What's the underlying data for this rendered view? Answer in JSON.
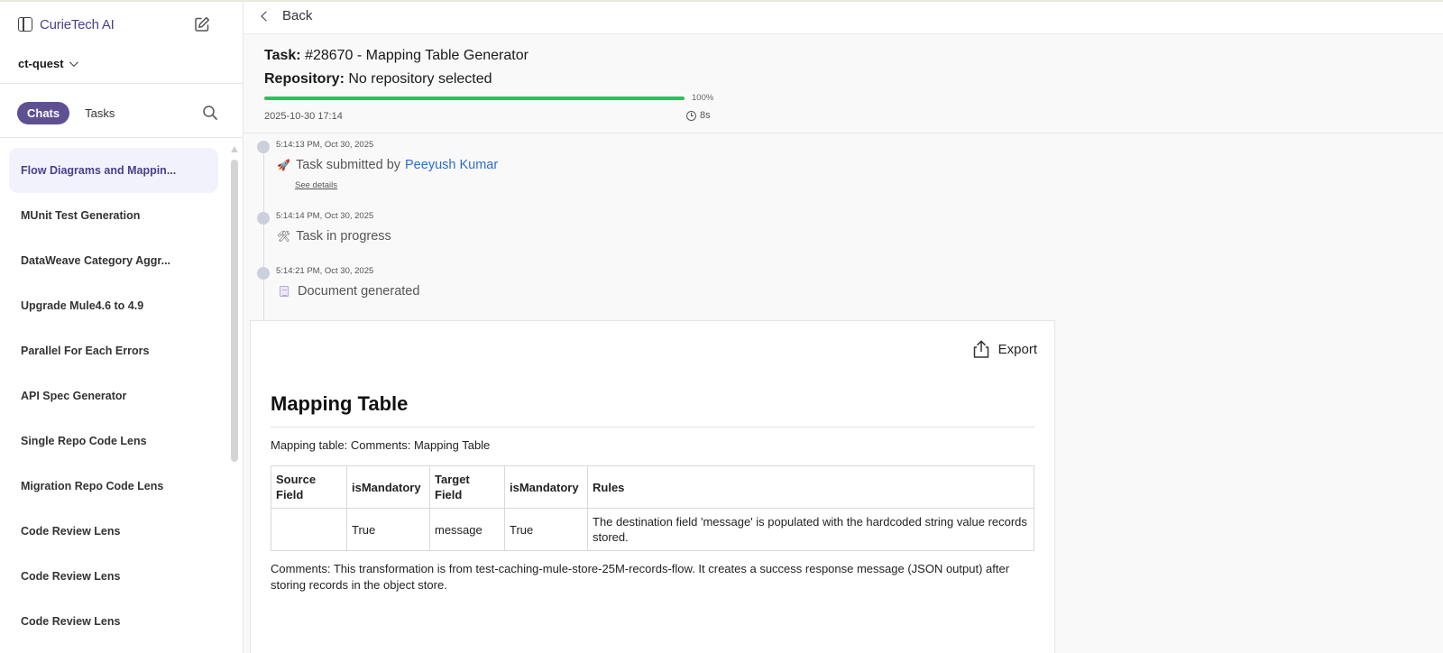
{
  "sidebar": {
    "brand": "CurieTech AI",
    "workspace": "ct-quest",
    "tabs": [
      {
        "label": "Chats",
        "active": true
      },
      {
        "label": "Tasks",
        "active": false
      }
    ],
    "chats": [
      "Flow Diagrams and Mappin...",
      "MUnit Test Generation",
      "DataWeave Category Aggr...",
      "Upgrade Mule4.6 to 4.9",
      "Parallel For Each Errors",
      "API Spec Generator",
      "Single Repo Code Lens",
      "Migration Repo Code Lens",
      "Code Review Lens",
      "Code Review Lens",
      "Code Review Lens"
    ]
  },
  "main": {
    "back_label": "Back",
    "task": {
      "label": "Task:",
      "value": "#28670 - Mapping Table Generator",
      "repo_label": "Repository:",
      "repo_value": "No repository selected",
      "progress": 100,
      "progress_text": "100%",
      "date": "2025-10-30 17:14",
      "duration": "8s"
    },
    "timeline": [
      {
        "time": "5:14:13 PM, Oct 30, 2025",
        "icon": "rocket-icon",
        "text": "Task submitted by",
        "user": "Peeyush Kumar",
        "details": "See details"
      },
      {
        "time": "5:14:14 PM, Oct 30, 2025",
        "icon": "tools-icon",
        "text": "Task in progress"
      },
      {
        "time": "5:14:21 PM, Oct 30, 2025",
        "icon": "document-icon",
        "text": "Document generated"
      }
    ],
    "document": {
      "export_label": "Export",
      "heading": "Mapping Table",
      "intro": "Mapping table: Comments: Mapping Table",
      "table": {
        "headers": [
          "Source Field",
          "isMandatory",
          "Target Field",
          "isMandatory",
          "Rules"
        ],
        "rows": [
          [
            "",
            "True",
            "message",
            "True",
            "The destination field 'message' is populated with the hardcoded string value records stored."
          ]
        ]
      },
      "comments": "Comments: This transformation is from test-caching-mule-store-25M-records-flow. It creates a success response message (JSON output) after storing records in the object store."
    }
  },
  "colors": {
    "accent": "#5f5094",
    "progress": "#22c55e",
    "link": "#2e6bd2"
  }
}
